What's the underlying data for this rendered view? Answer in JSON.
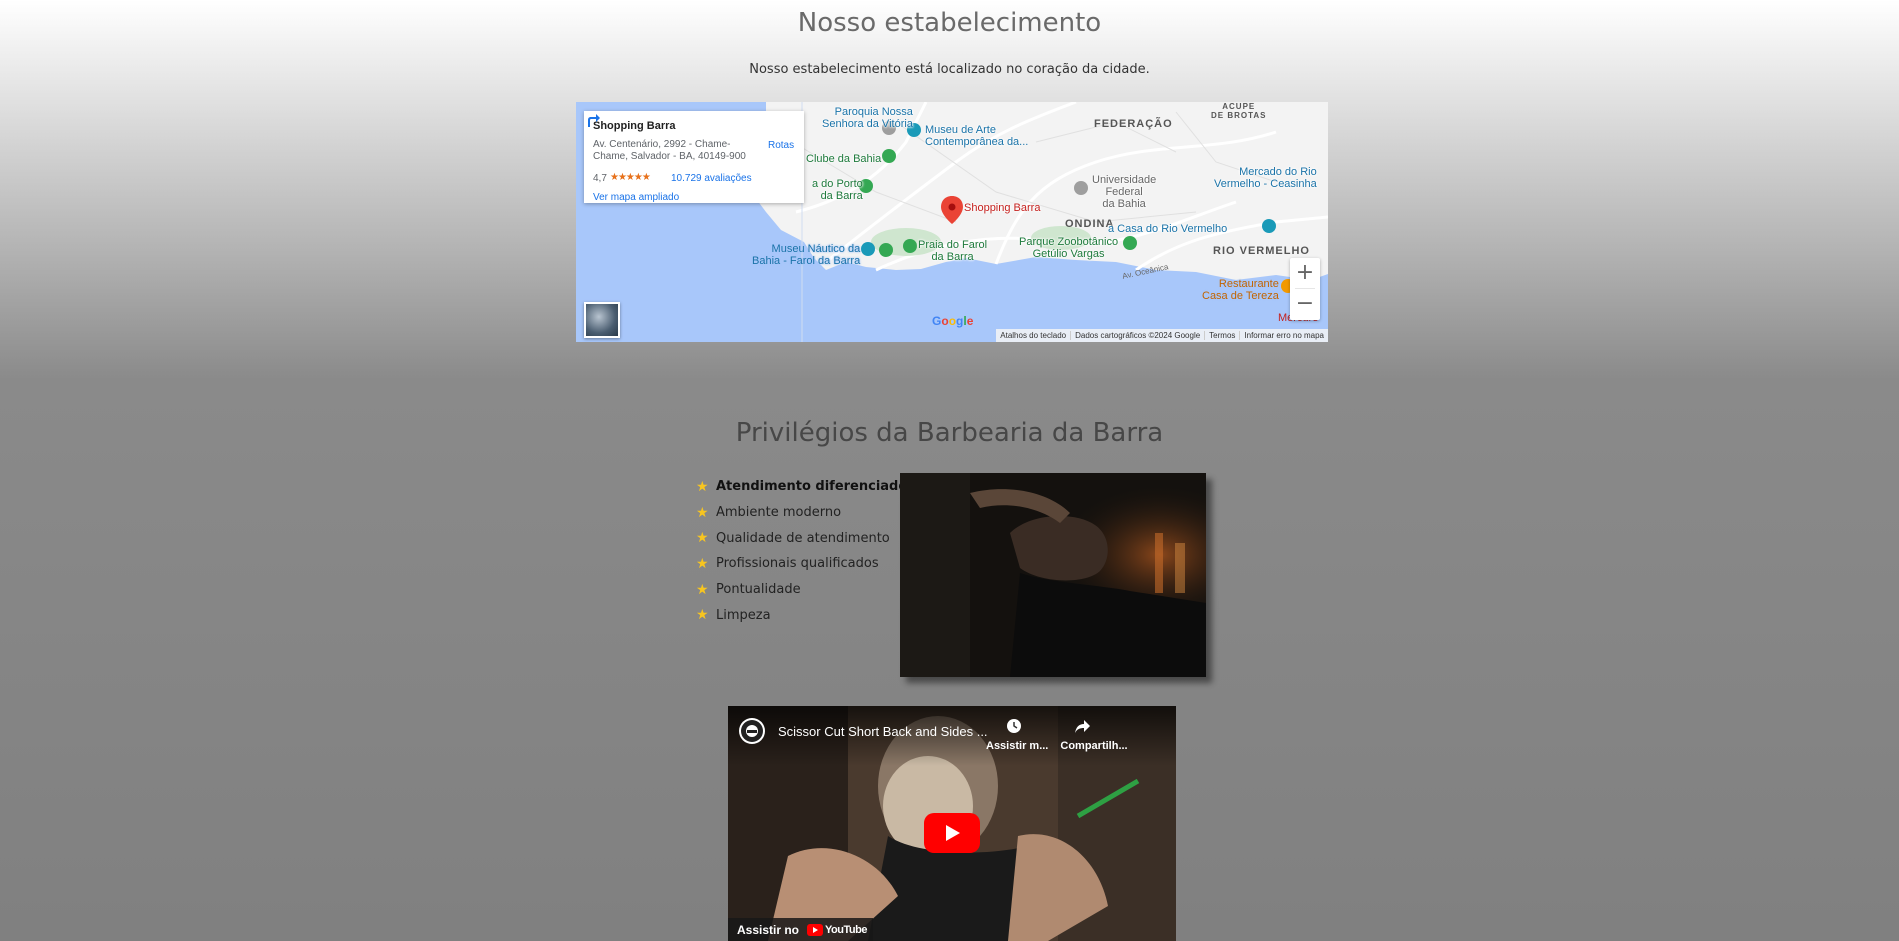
{
  "location_section": {
    "title": "Nosso estabelecimento",
    "subtitle": "Nosso estabelecimento está localizado no coração da cidade."
  },
  "map": {
    "place_card": {
      "name": "Shopping Barra",
      "address": "Av. Centenário, 2992 - Chame-Chame, Salvador - BA, 40149-900",
      "rating": "4,7",
      "stars": "★★★★★",
      "reviews": "10.729 avaliações",
      "link": "Ver mapa ampliado",
      "route": "Rotas"
    },
    "labels": {
      "paroquia": "Paroquia Nossa\nSenhora da Vitória",
      "museu_arte": "Museu de Arte\nContemporânea da...",
      "federacao": "FEDERAÇÃO",
      "acupe": "ACUPE\nDE BROTAS",
      "clube": "Clube da Bahia",
      "porto": "a do Porto\nda Barra",
      "mercado": "Mercado do Rio\nVermelho - Ceasinha",
      "universidade": "Universidade\nFederal\nda Bahia",
      "shopping": "Shopping Barra",
      "ondina": "ONDINA",
      "casa_rio": "a Casa do Rio Vermelho",
      "museu_nautico": "Museu Náutico da\nBahia - Farol da Barra",
      "praia": "Praia do Farol\nda Barra",
      "parque": "Parque Zoobotânico\nGetúlio Vargas",
      "rio_vermelho": "RIO VERMELHO",
      "oceanica": "Av. Oceânica",
      "restaurante": "Restaurante\nCasa de Tereza",
      "mercure": "Mercure"
    },
    "zoom_in": "+",
    "zoom_out": "−",
    "google": "Google",
    "attribution": {
      "shortcuts": "Atalhos do teclado",
      "data": "Dados cartográficos ©2024 Google",
      "terms": "Termos",
      "report": "Informar erro no mapa"
    },
    "colors": {
      "water": "#a8c7fa",
      "land": "#f3f3f3",
      "park": "#cfe6cf",
      "pin": "#ea4335"
    }
  },
  "privileges_section": {
    "title": "Privilégios da Barbearia da Barra",
    "features": [
      "Atendimento diferenciado",
      "Ambiente moderno",
      "Qualidade de atendimento",
      "Profissionais qualificados",
      "Pontualidade",
      "Limpeza"
    ],
    "star_icon": "★",
    "star_color": "#f7c520"
  },
  "video": {
    "title": "Scissor Cut Short Back and Sides ...",
    "watch_later": "Assistir m...",
    "share": "Compartilh...",
    "watch_on": "Assistir no",
    "youtube": "YouTube"
  }
}
